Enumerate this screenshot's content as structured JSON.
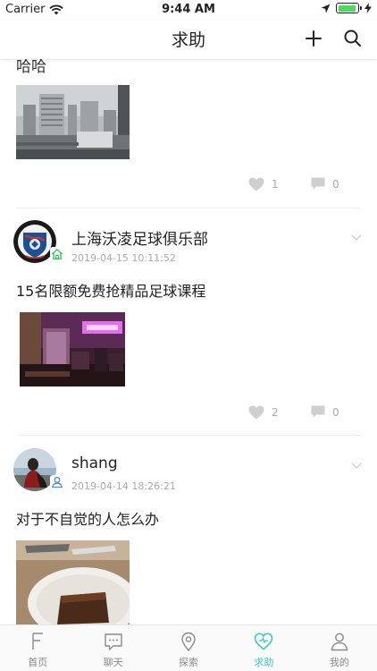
{
  "status_bar": {
    "carrier": "Carrier",
    "time": "9:44 AM",
    "battery_level": 0.95
  },
  "nav": {
    "title": "求助"
  },
  "feed": {
    "partial_post": {
      "text": "哈哈",
      "likes": "1",
      "comments": "0"
    },
    "posts": [
      {
        "author": "上海沃凌足球俱乐部",
        "time": "2019-04-15 10:11:52",
        "text": "15名限额免费抢精品足球课程",
        "likes": "2",
        "comments": "0"
      },
      {
        "author": "shang",
        "time": "2019-04-14 18:26:21",
        "text": "对于不自觉的人怎么办"
      }
    ]
  },
  "tabs": [
    {
      "label": "首页",
      "icon": "home-f-icon"
    },
    {
      "label": "聊天",
      "icon": "chat-icon"
    },
    {
      "label": "探索",
      "icon": "location-pin-icon"
    },
    {
      "label": "求助",
      "icon": "heart-icon",
      "active": true
    },
    {
      "label": "我的",
      "icon": "person-icon"
    }
  ],
  "colors": {
    "accent": "#3cc8c0",
    "badge_green": "#34c759",
    "badge_blue": "#4a90e2"
  }
}
